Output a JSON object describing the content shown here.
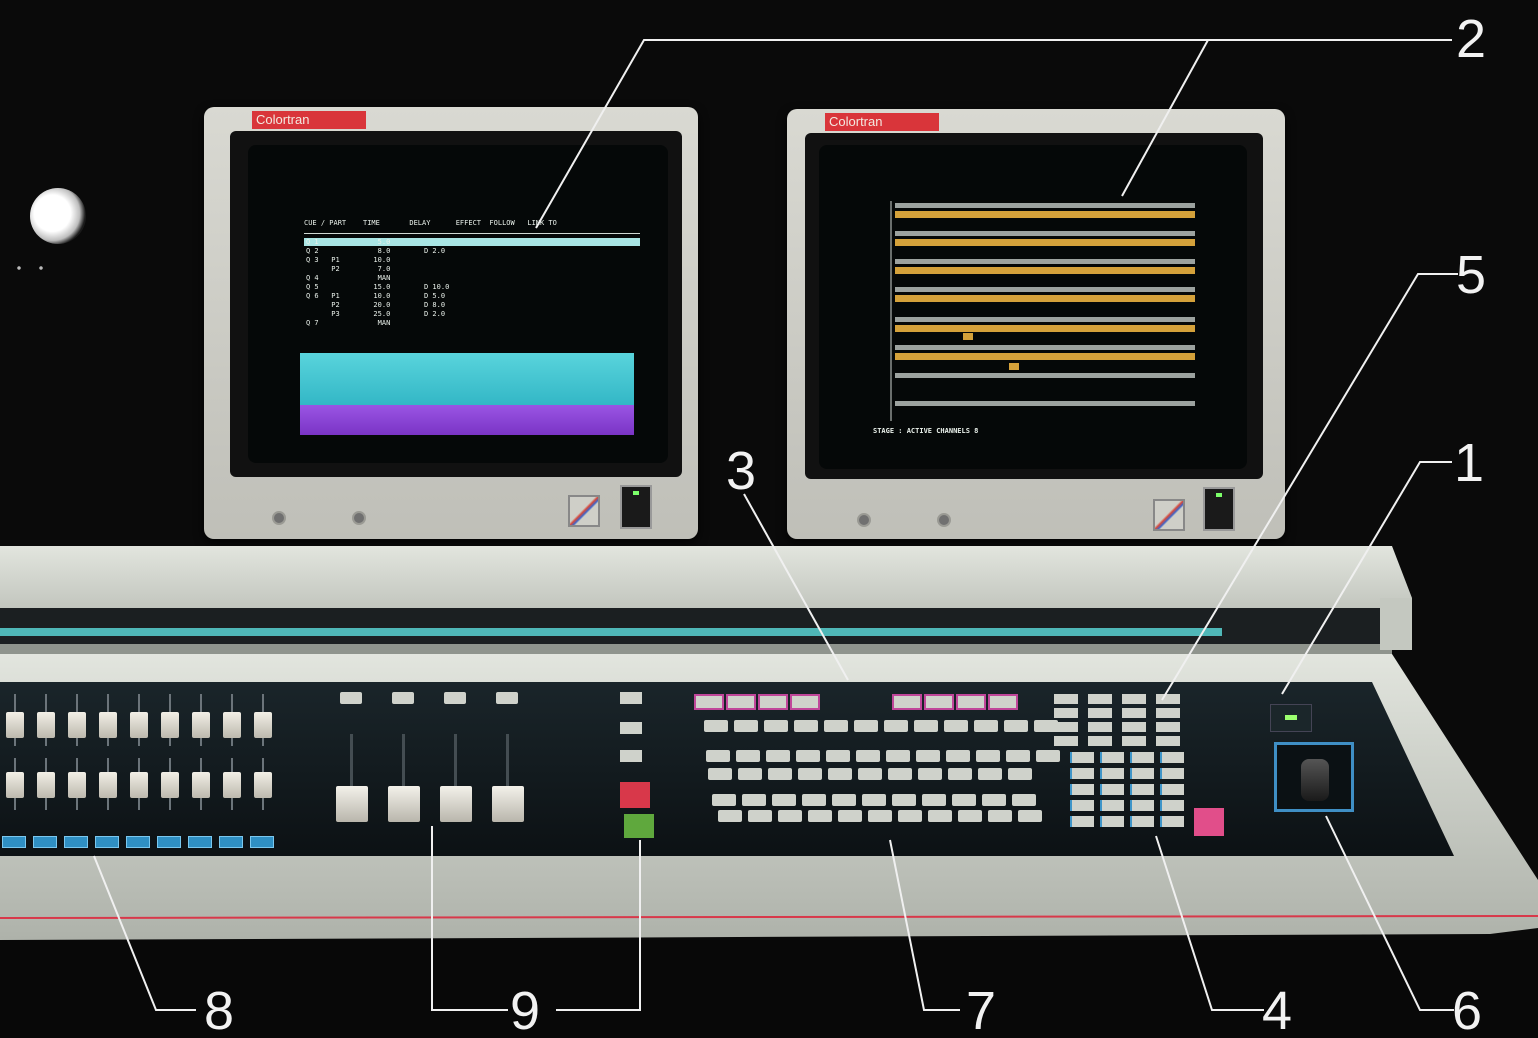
{
  "monitor_left": {
    "brand": "Colortran",
    "header": "CUE / PART    TIME       DELAY      EFFECT  FOLLOW   LINK TO",
    "rows": [
      "Q 1              5.0",
      "Q 2              8.0        D 2.0",
      "Q 3   P1        10.0",
      "      P2         7.0",
      "Q 4              MAN",
      "Q 5             15.0        D 10.0",
      "Q 6   P1        10.0        D 5.0",
      "      P2        20.0        D 8.0",
      "      P3        25.0        D 2.0",
      "Q 7              MAN"
    ]
  },
  "monitor_right": {
    "brand": "Colortran",
    "status": "STAGE : ACTIVE CHANNELS 8"
  },
  "callouts": [
    "1",
    "2",
    "3",
    "4",
    "5",
    "6",
    "7",
    "8",
    "9"
  ],
  "colors": {
    "console_shell": "#c9ccc4",
    "panel": "#10181c",
    "teal_strip": "#4fb7b7",
    "cyan_band": "#3ec3cf",
    "violet_band": "#8a44d8",
    "amber": "#d4a13a",
    "red": "#d8384a",
    "green": "#5fa83d"
  }
}
